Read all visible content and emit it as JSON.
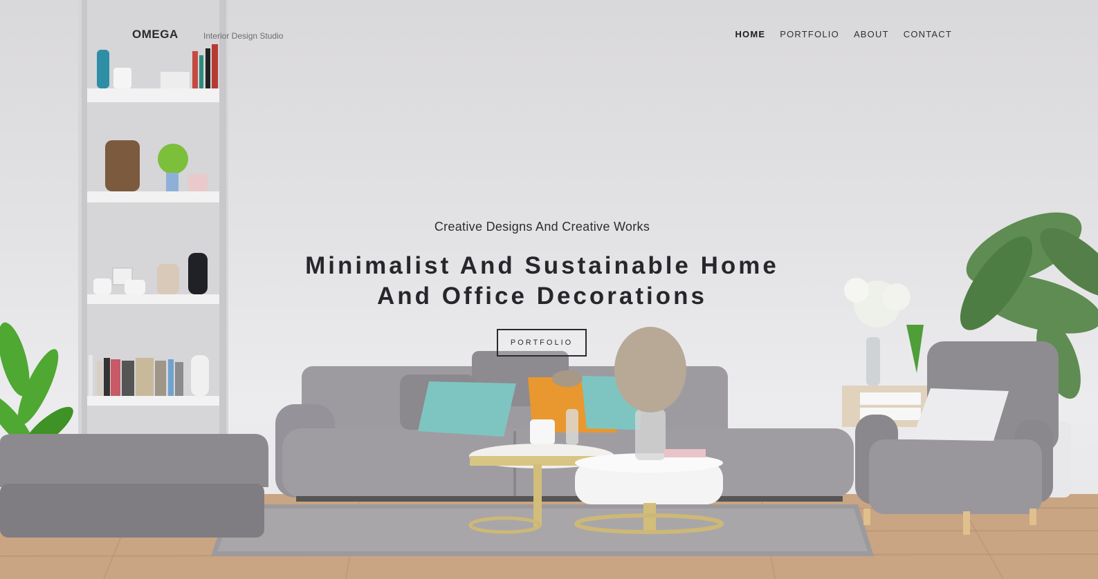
{
  "header": {
    "logo": "OMEGA",
    "tagline": "Interior Design Studio"
  },
  "nav": {
    "items": [
      {
        "label": "HOME",
        "active": true
      },
      {
        "label": "PORTFOLIO",
        "active": false
      },
      {
        "label": "ABOUT",
        "active": false
      },
      {
        "label": "CONTACT",
        "active": false
      }
    ]
  },
  "hero": {
    "subtitle": "Creative Designs And Creative Works",
    "title_line1": "Minimalist And Sustainable Home",
    "title_line2": "And Office Decorations",
    "button_label": "PORTFOLIO"
  },
  "colors": {
    "wall": "#e4e3e5",
    "sofa": "#9a979c",
    "floor": "#c9a584",
    "text": "#27272b"
  }
}
